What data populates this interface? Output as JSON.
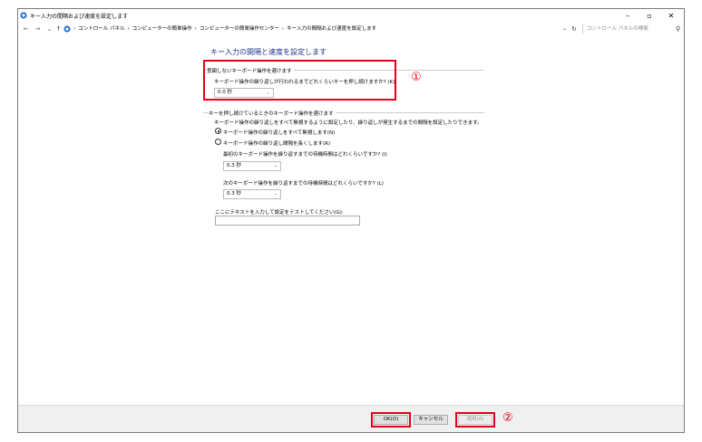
{
  "window": {
    "title": "キー入力の間隔および速度を設定します",
    "minimize_label": "–",
    "maximize_label": "▫",
    "close_label": "✕"
  },
  "address": {
    "crumbs": [
      "コントロール パネル",
      "コンピューターの簡単操作",
      "コンピューターの簡単操作センター",
      "キー入力の間隔および速度を設定します"
    ],
    "search_placeholder": "コントロール パネルの検索"
  },
  "page": {
    "title": "キー入力の間隔と速度を設定します",
    "group1": {
      "legend": "意図しないキーボード操作を避けます",
      "question": "キーボード操作の繰り返しが行われるまでどれくらいキーを押し続けますか? (K)",
      "select_value": "0.0 秒",
      "marker": "①"
    },
    "group2": {
      "legend": "キーを押し続けているときのキーボード操作を避けます",
      "description": "キーボード操作の繰り返しをすべて無視するように設定したり、繰り返しが発生するまでの間隔を設定したりできます。",
      "radio1": "キーボード操作の繰り返しをすべて無視します(N)",
      "radio2": "キーボード操作の繰り返し間隔を長くします(R)",
      "q1": "最初のキーボード操作を繰り返すまでの待機時間はどれくらいですか? (I)",
      "q1_value": "0.3 秒",
      "q2": "次のキーボード操作を繰り返すまでの待機時間はどれくらいですか? (L)",
      "q2_value": "0.3 秒"
    },
    "test_label": "ここにテキストを入力して設定をテストしてください(G):"
  },
  "footer": {
    "ok": "OK(O)",
    "cancel": "キャンセル",
    "apply": "適用(A)",
    "marker": "②"
  },
  "colors": {
    "highlight": "#e3001b",
    "title": "#1e3287"
  }
}
